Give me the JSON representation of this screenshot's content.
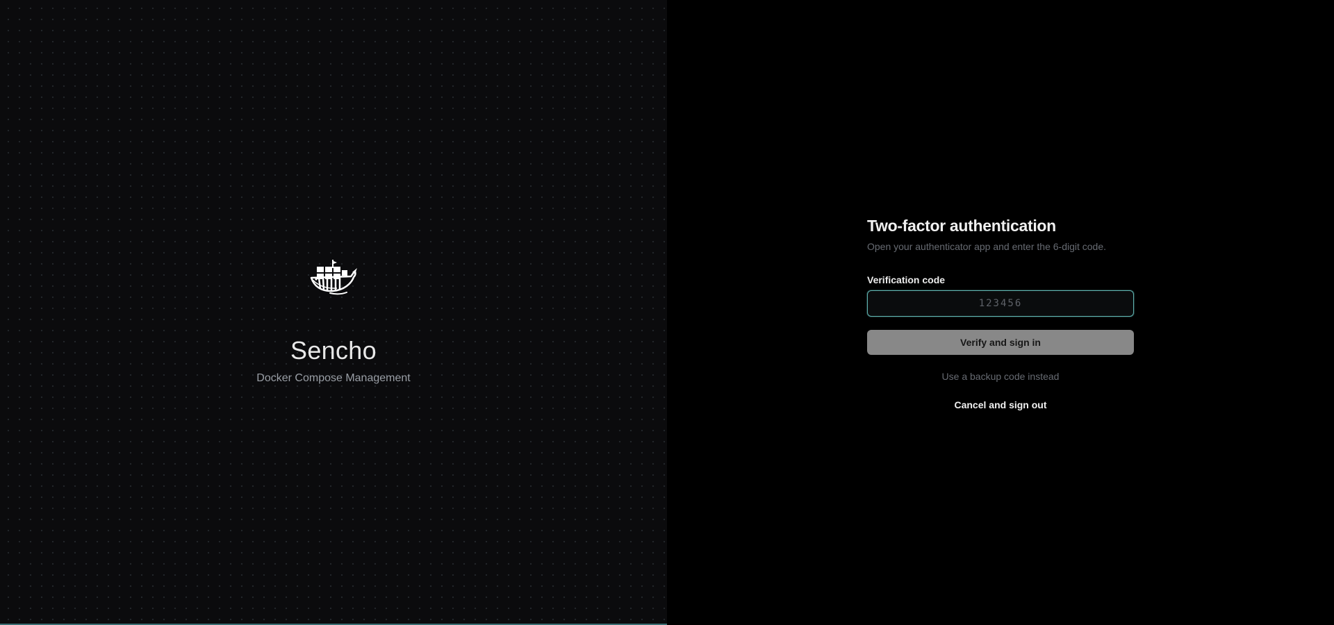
{
  "brand": {
    "logo_icon": "whale-ship-icon",
    "name": "Sencho",
    "tagline": "Docker Compose Management"
  },
  "auth": {
    "title": "Two-factor authentication",
    "description": "Open your authenticator app and enter the 6-digit code.",
    "code_label": "Verification code",
    "code_value": "",
    "code_placeholder": "123456",
    "verify_label": "Verify and sign in",
    "backup_link": "Use a backup code instead",
    "cancel_link": "Cancel and sign out"
  },
  "colors": {
    "background": "#000000",
    "panel": "#0b0b0d",
    "accent": "#5fb3b0",
    "button": "#888888"
  }
}
